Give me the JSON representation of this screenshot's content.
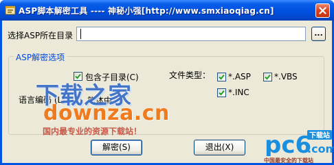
{
  "window": {
    "title": "ASP脚本解密工具 ---- 神秘小强[http://www.smxiaoqiag.cn]",
    "close_icon": "close-icon",
    "app_icon": "app-icon",
    "titlebar_color": "#0054e3"
  },
  "path_row": {
    "label": "选择ASP所在目录",
    "value": "",
    "browse_label": "..."
  },
  "options_group": {
    "legend": "ASP解密选项",
    "include_subdirs": {
      "label": "包含子目录(C)",
      "checked": true
    },
    "file_types_label": "文件类型：",
    "file_types": [
      {
        "label": "*.ASP",
        "checked": true
      },
      {
        "label": "*.VBS",
        "checked": true
      },
      {
        "label": "*.INC",
        "checked": true
      }
    ],
    "language_label": "语言编码 (L):",
    "language_value": "简体中文"
  },
  "buttons": {
    "decrypt": "解密(S)",
    "exit": "退出(X)"
  },
  "watermarks": {
    "downza_cn": "下载之家",
    "downza_en": "downza.cn",
    "downza_tagline": "国内最专业的资源下载站！",
    "pc6_logo": "pc6",
    "pc6_suffix": ".com",
    "pc6_badge": "下载站",
    "pc6_tagline": "中国最安全的下载站"
  },
  "colors": {
    "legend_blue": "#0046d5",
    "checkmark_green": "#21a121",
    "watermark_blue": "#3b6fc9",
    "watermark_orange": "#f07b1e",
    "pc6_blue": "#1a8fe0"
  }
}
